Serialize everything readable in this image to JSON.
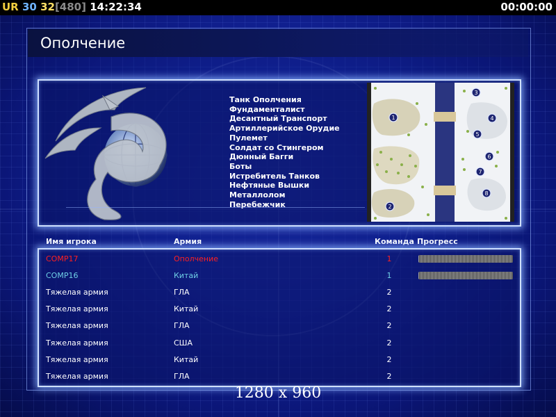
{
  "hud": {
    "ur": "UR",
    "lag": "30",
    "fps": "32",
    "fps_cap": "[480]",
    "clock": "14:22:34",
    "timer": "00:00:00"
  },
  "title": "Ополчение",
  "units": [
    "Танк Ополчения",
    "Фундаменталист",
    "Десантный Транспорт",
    "Артиллерийское Орудие",
    "Пулемет",
    "Солдат со Стингером",
    "Дюнный Багги",
    "Боты",
    "Истребитель Танков",
    "Нефтяные Вышки",
    "Металлолом",
    "Перебежчик"
  ],
  "minimap": {
    "start_positions": [
      "1",
      "2",
      "3",
      "4",
      "5",
      "6",
      "7",
      "8"
    ]
  },
  "table": {
    "headers": {
      "name": "Имя игрока",
      "army": "Армия",
      "team": "Команда",
      "progress": "Прогресс"
    },
    "rows": [
      {
        "name": "COMP17",
        "army": "Ополчение",
        "team": "1",
        "color": "#ff2020",
        "progress": 1.0
      },
      {
        "name": "COMP16",
        "army": "Китай",
        "team": "1",
        "color": "#6fd0e6",
        "progress": 1.0
      },
      {
        "name": "Тяжелая армия",
        "army": "ГЛА",
        "team": "2",
        "color": "#ffffff"
      },
      {
        "name": "Тяжелая армия",
        "army": "Китай",
        "team": "2",
        "color": "#ffffff"
      },
      {
        "name": "Тяжелая армия",
        "army": "ГЛА",
        "team": "2",
        "color": "#ffffff"
      },
      {
        "name": "Тяжелая армия",
        "army": "США",
        "team": "2",
        "color": "#ffffff"
      },
      {
        "name": "Тяжелая армия",
        "army": "Китай",
        "team": "2",
        "color": "#ffffff"
      },
      {
        "name": "Тяжелая армия",
        "army": "ГЛА",
        "team": "2",
        "color": "#ffffff"
      }
    ]
  },
  "resolution": "1280 x 960"
}
